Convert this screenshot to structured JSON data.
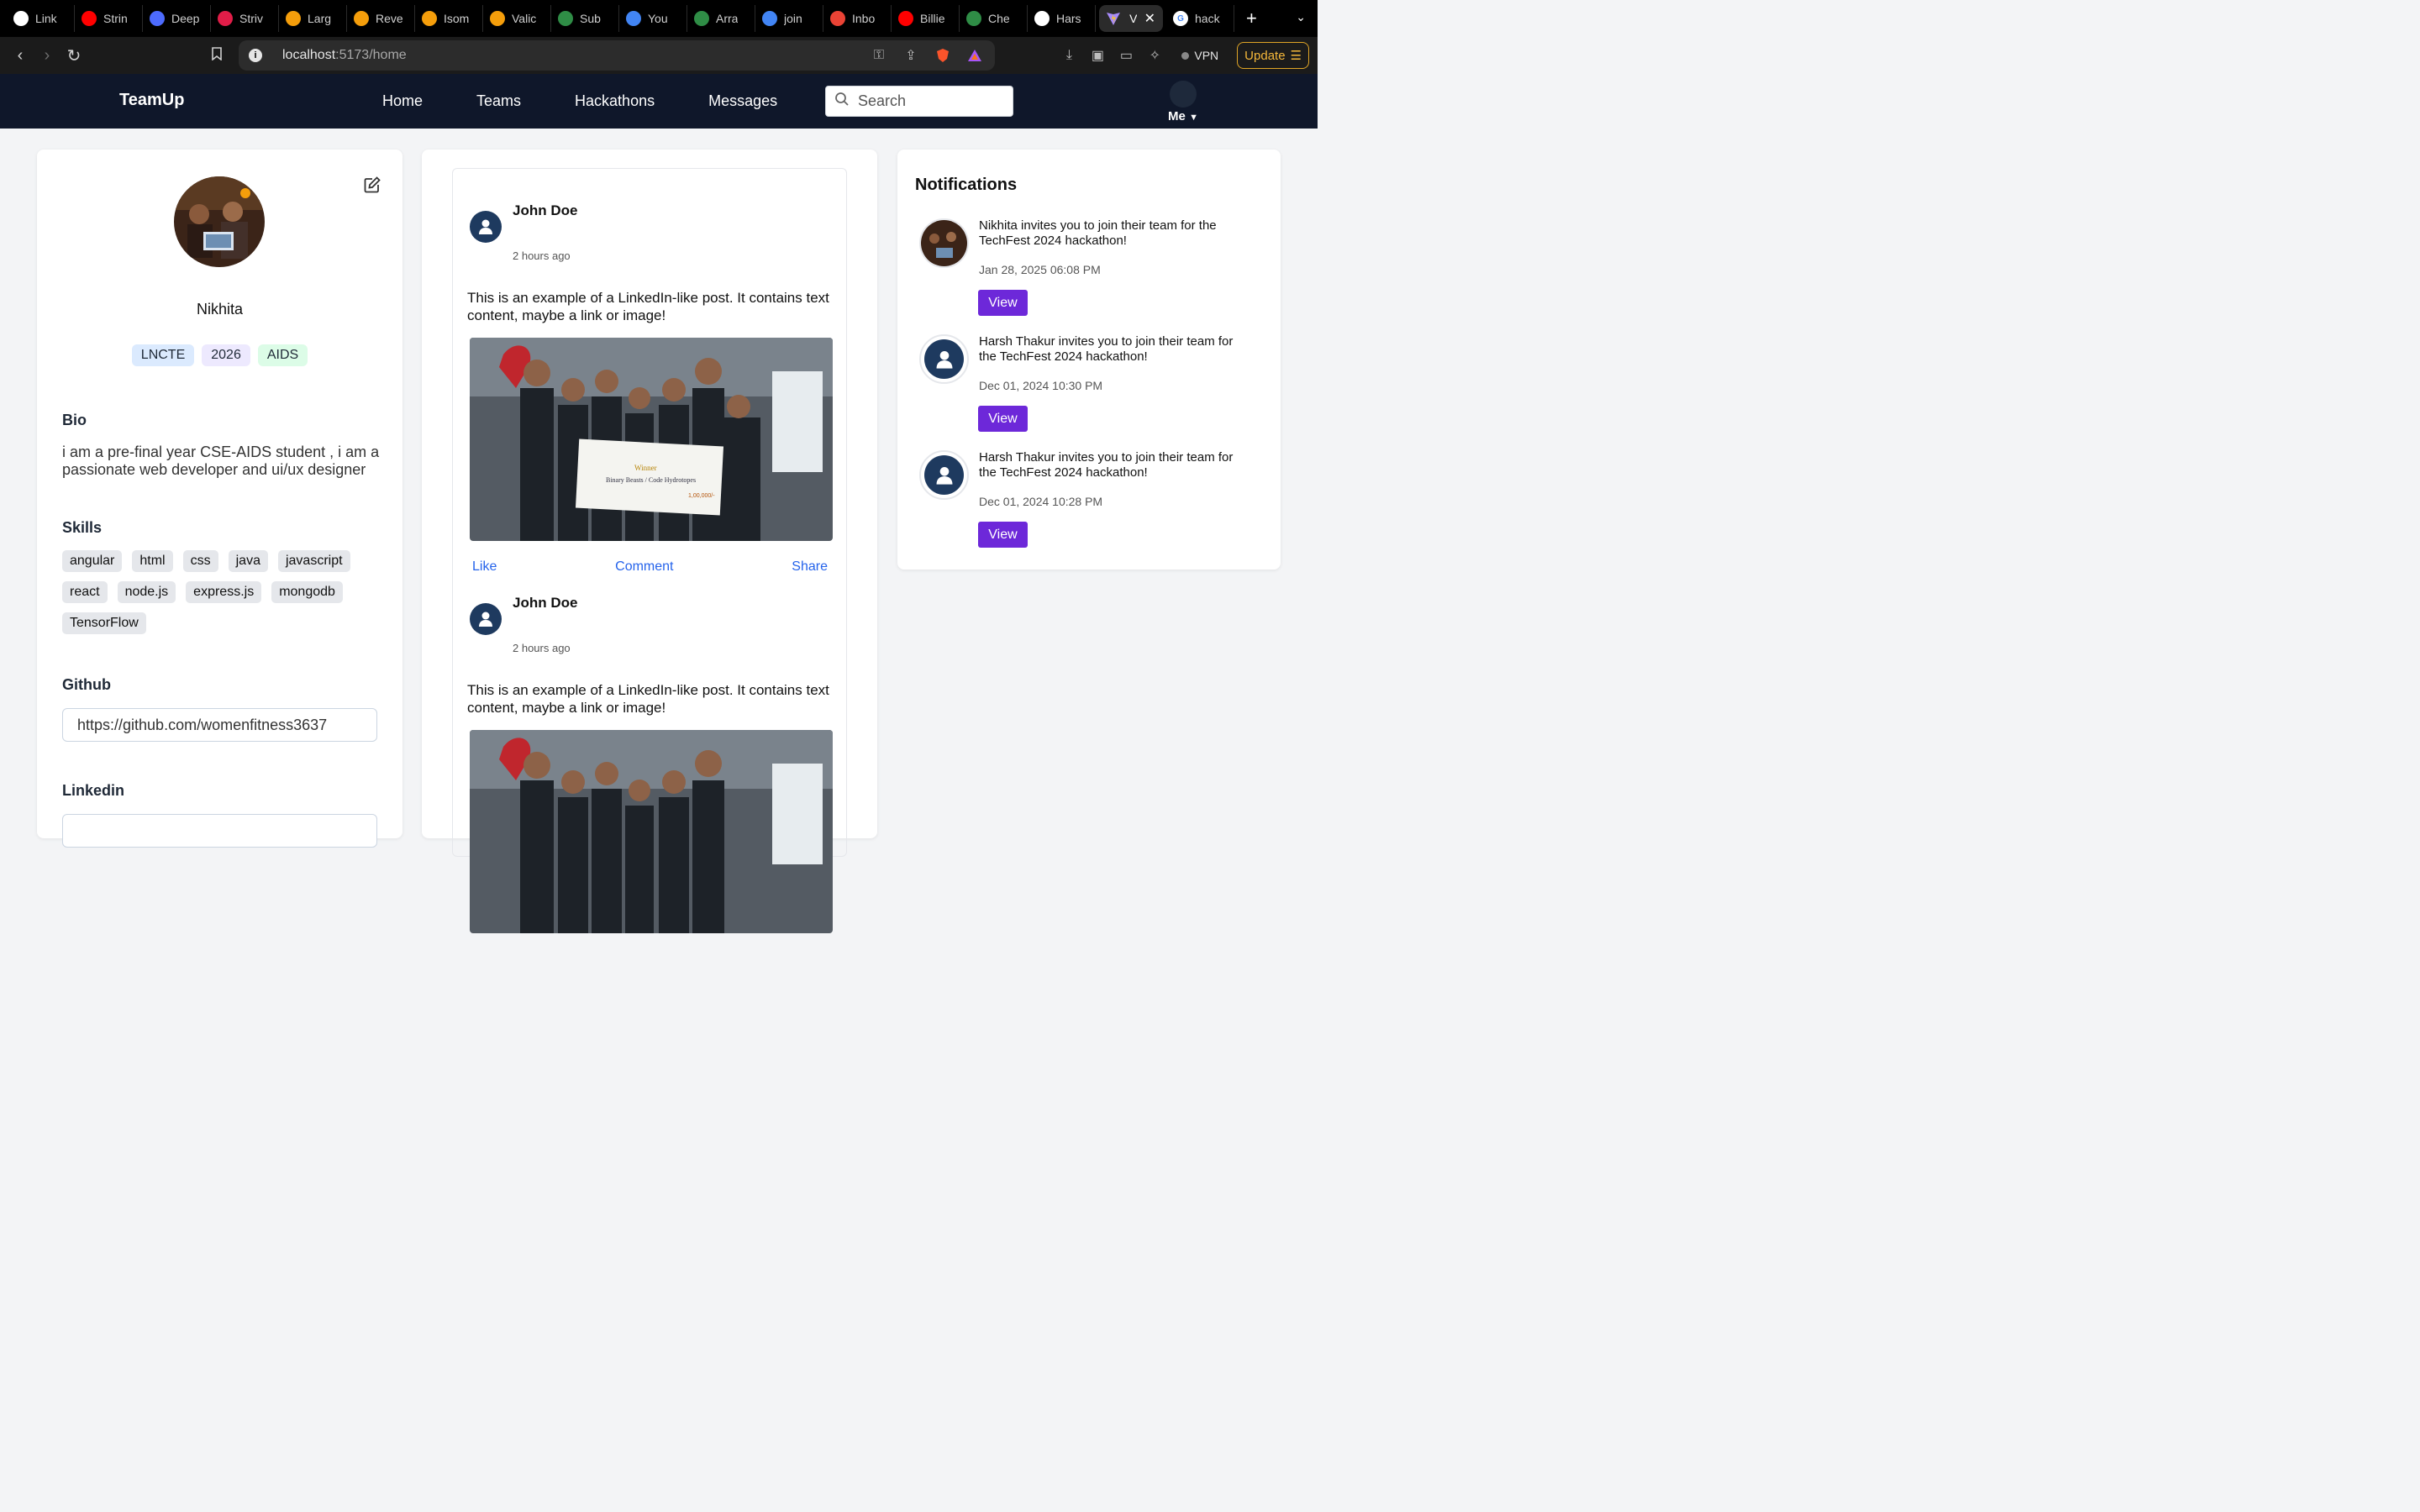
{
  "browser": {
    "tabs": [
      {
        "label": "Link",
        "icon": "openai-icon",
        "color": "#ffffff"
      },
      {
        "label": "Strin",
        "icon": "youtube-icon",
        "color": "#ff0000"
      },
      {
        "label": "Deep",
        "icon": "deepseek-icon",
        "color": "#4d6bfe"
      },
      {
        "label": "Striv",
        "icon": "tuf-icon",
        "color": "#e11d48"
      },
      {
        "label": "Larg",
        "icon": "code-icon",
        "color": "#f59e0b"
      },
      {
        "label": "Reve",
        "icon": "code-icon",
        "color": "#f59e0b"
      },
      {
        "label": "Isom",
        "icon": "code-icon",
        "color": "#f59e0b"
      },
      {
        "label": "Valic",
        "icon": "code-icon",
        "color": "#f59e0b"
      },
      {
        "label": "Sub",
        "icon": "gfg-icon",
        "color": "#2f8d46"
      },
      {
        "label": "You",
        "icon": "google-icon",
        "color": "#4285f4"
      },
      {
        "label": "Arra",
        "icon": "gfg-icon",
        "color": "#2f8d46"
      },
      {
        "label": "join",
        "icon": "google-icon",
        "color": "#4285f4"
      },
      {
        "label": "Inbo",
        "icon": "gmail-icon",
        "color": "#ea4335"
      },
      {
        "label": "Billie",
        "icon": "youtube-icon",
        "color": "#ff0000"
      },
      {
        "label": "Che",
        "icon": "gfg-icon",
        "color": "#2f8d46"
      },
      {
        "label": "Hars",
        "icon": "github-icon",
        "color": "#ffffff"
      }
    ],
    "active_tab": {
      "label": "V",
      "icon": "vite-icon"
    },
    "last_tab": {
      "label": "hack",
      "icon": "google-icon"
    },
    "url_host": "localhost",
    "url_rest": ":5173/home",
    "vpn_label": "VPN",
    "update_label": "Update"
  },
  "app": {
    "brand": "TeamUp",
    "nav": [
      "Home",
      "Teams",
      "Hackathons",
      "Messages"
    ],
    "search_placeholder": "Search",
    "me_label": "Me"
  },
  "profile": {
    "name": "Nikhita",
    "tags": [
      "LNCTE",
      "2026",
      "AIDS"
    ],
    "bio_title": "Bio",
    "bio": "i am a pre-final year CSE-AIDS student , i am a passionate web developer and ui/ux designer",
    "skills_title": "Skills",
    "skills": [
      "angular",
      "html",
      "css",
      "java",
      "javascript",
      "react",
      "node.js",
      "express.js",
      "mongodb",
      "TensorFlow"
    ],
    "github_title": "Github",
    "github_value": "https://github.com/womenfitness3637",
    "linkedin_title": "Linkedin"
  },
  "feed": {
    "posts": [
      {
        "author": "John Doe",
        "time": "2 hours ago",
        "text": "This is an example of a LinkedIn-like post. It contains text content, maybe a link or image!",
        "like": "Like",
        "comment": "Comment",
        "share": "Share"
      },
      {
        "author": "John Doe",
        "time": "2 hours ago",
        "text": "This is an example of a LinkedIn-like post. It contains text content, maybe a link or image!"
      }
    ]
  },
  "notifications": {
    "title": "Notifications",
    "items": [
      {
        "message": "Nikhita invites you to join their team for the TechFest 2024 hackathon!",
        "date": "Jan 28, 2025 06:08 PM",
        "button": "View"
      },
      {
        "message": "Harsh Thakur invites you to join their team for the TechFest 2024 hackathon!",
        "date": "Dec 01, 2024 10:30 PM",
        "button": "View"
      },
      {
        "message": "Harsh Thakur invites you to join their team for the TechFest 2024 hackathon!",
        "date": "Dec 01, 2024 10:28 PM",
        "button": "View"
      }
    ]
  },
  "colors": {
    "nav_bg": "#0f172a",
    "accent_button": "#6d28d9",
    "link": "#2563eb",
    "update": "#f4b73a"
  }
}
